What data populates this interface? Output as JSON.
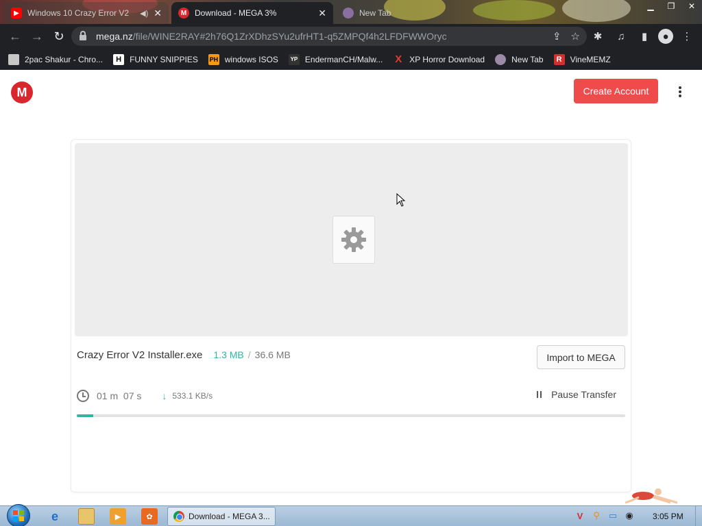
{
  "browser": {
    "tabs": [
      {
        "title": "Windows 10 Crazy Error V2",
        "favicon": "youtube-icon",
        "state": "inactive"
      },
      {
        "title": "Download - MEGA 3%",
        "favicon": "mega-icon",
        "state": "active"
      },
      {
        "title": "New Tab",
        "favicon": "new-tab-icon",
        "state": "inactive"
      }
    ],
    "url_host": "mega.nz",
    "url_path": "/file/WINE2RAY#2h76Q1ZrXDhzSYu2ufrHT1-q5ZMPQf4h2LFDFWWOryc",
    "bookmarks": [
      {
        "label": "2pac Shakur - Chro...",
        "icon": "bookmark-bag-icon"
      },
      {
        "label": "FUNNY SNIPPIES",
        "icon": "h-icon"
      },
      {
        "label": "windows ISOS",
        "icon": "ph-icon"
      },
      {
        "label": "EndermanCH/Malw...",
        "icon": "yp-icon"
      },
      {
        "label": "XP Horror Download",
        "icon": "x-icon"
      },
      {
        "label": "New Tab",
        "icon": "globe-icon"
      },
      {
        "label": "VineMEMZ",
        "icon": "r-icon"
      }
    ]
  },
  "header": {
    "logo_letter": "M",
    "create_account": "Create Account"
  },
  "download": {
    "file_name": "Crazy Error V2 Installer.exe",
    "downloaded": "1.3 MB",
    "separator": "/",
    "total": "36.6 MB",
    "import_label": "Import to MEGA",
    "time_remaining": "01 m  07 s",
    "speed": "533.1 KB/s",
    "pause_label": "Pause Transfer",
    "progress_percent": 3
  },
  "taskbar": {
    "active_task": "Download - MEGA 3...",
    "clock": "3:05 PM"
  },
  "colors": {
    "mega_red": "#d9272e",
    "create_button": "#f04b4b",
    "progress_green": "#31b4a0"
  }
}
